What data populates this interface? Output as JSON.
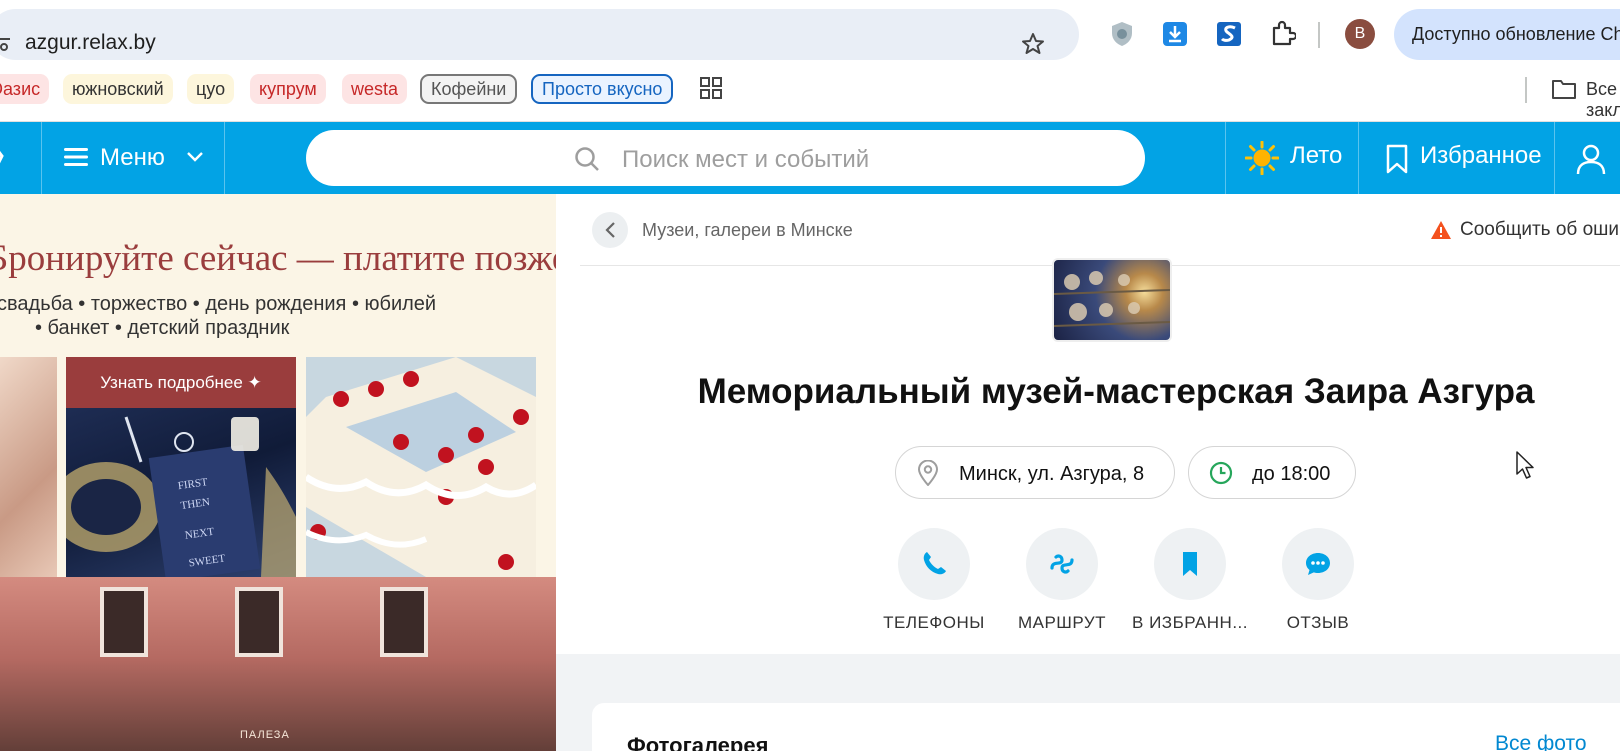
{
  "browser": {
    "url": "azgur.relax.by",
    "profile_initial": "B",
    "update_text": "Доступно обновление Chrome"
  },
  "bookmarks": {
    "items": [
      "Оазис",
      "южновский",
      "цуо",
      "купрум",
      "westa",
      "Кофейни",
      "Просто вкусно"
    ],
    "all_label": "Все закладки"
  },
  "site_header": {
    "menu_label": "Меню",
    "search_placeholder": "Поиск мест и событий",
    "season_label": "Лето",
    "favorites_label": "Избранное",
    "accent_color": "#02a3e5"
  },
  "promo": {
    "title": "Бронируйте сейчас — платите позже",
    "line1": "свадьба • торжество • день рождения • юбилей",
    "line2": "• банкет • детский праздник",
    "cta": "Узнать подробнее ✦",
    "sign_text": "ПАЛЕЗА",
    "accent_color": "#9a3d3d"
  },
  "main": {
    "breadcrumb": "Музеи, галереи в Минске",
    "report_label": "Сообщить об ошибке",
    "title": "Мемориальный музей-мастерская Заира Азгура",
    "address": "Минск, ул. Азгура, 8",
    "hours": "до 18:00",
    "actions": [
      {
        "label": "ТЕЛЕФОНЫ",
        "icon": "phone-icon"
      },
      {
        "label": "МАРШРУТ",
        "icon": "route-icon"
      },
      {
        "label": "В ИЗБРАНН...",
        "icon": "bookmark-icon"
      },
      {
        "label": "ОТЗЫВ",
        "icon": "comment-icon"
      }
    ]
  },
  "gallery": {
    "title": "Фотогалерея",
    "all_label": "Все фото"
  }
}
